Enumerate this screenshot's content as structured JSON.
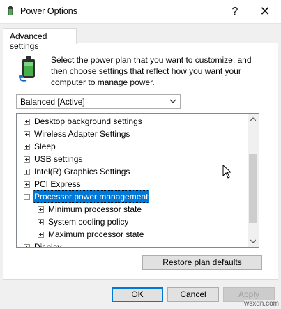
{
  "window": {
    "title": "Power Options",
    "help_glyph": "?",
    "close_glyph": "✕"
  },
  "tab": {
    "label": "Advanced settings"
  },
  "description": "Select the power plan that you want to customize, and then choose settings that reflect how you want your computer to manage power.",
  "plan_select": {
    "selected": "Balanced [Active]"
  },
  "tree": {
    "items": [
      {
        "label": "Desktop background settings",
        "expanded": false,
        "selected": false
      },
      {
        "label": "Wireless Adapter Settings",
        "expanded": false,
        "selected": false
      },
      {
        "label": "Sleep",
        "expanded": false,
        "selected": false
      },
      {
        "label": "USB settings",
        "expanded": false,
        "selected": false
      },
      {
        "label": "Intel(R) Graphics Settings",
        "expanded": false,
        "selected": false
      },
      {
        "label": "PCI Express",
        "expanded": false,
        "selected": false
      },
      {
        "label": "Processor power management",
        "expanded": true,
        "selected": true
      },
      {
        "label": "Minimum processor state",
        "expanded": false,
        "selected": false
      },
      {
        "label": "System cooling policy",
        "expanded": false,
        "selected": false
      },
      {
        "label": "Maximum processor state",
        "expanded": false,
        "selected": false
      },
      {
        "label": "Display",
        "expanded": false,
        "selected": false
      }
    ]
  },
  "buttons": {
    "restore": "Restore plan defaults",
    "ok": "OK",
    "cancel": "Cancel",
    "apply": "Apply"
  },
  "watermark": "wsxdn.com",
  "colors": {
    "selection": "#0078d7",
    "default_button_border": "#0078d7",
    "disabled_text": "#a0a0a0"
  },
  "icons": {
    "title": "power-options-icon",
    "plan": "battery-plug-icon"
  }
}
